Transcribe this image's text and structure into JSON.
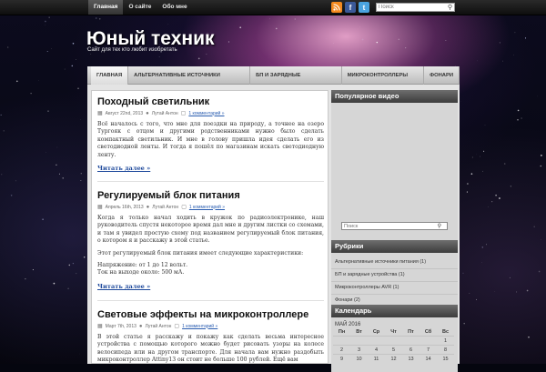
{
  "topnav": [
    {
      "label": "Главная",
      "active": true
    },
    {
      "label": "О сайте",
      "active": false
    },
    {
      "label": "Обо мне",
      "active": false
    }
  ],
  "social": {
    "rss": {
      "icon": "rss-icon",
      "color": "#f58a1f"
    },
    "facebook": {
      "icon": "facebook-icon",
      "glyph": "f",
      "color": "#3b5998"
    },
    "twitter": {
      "icon": "twitter-icon",
      "glyph": "t",
      "color": "#4aa3df"
    }
  },
  "top_search": {
    "placeholder": "Поиск"
  },
  "site": {
    "title": "Юный техник",
    "description": "Сайт для тех кто любит изобретать"
  },
  "mainnav": [
    {
      "label": "ГЛАВНАЯ",
      "active": true
    },
    {
      "label": "АЛЬТЕРНАТИВНЫЕ ИСТОЧНИКИ ПИТАНИЯ",
      "active": false
    },
    {
      "label": "БП И ЗАРЯДНЫЕ УСТРОЙСТВА",
      "active": false
    },
    {
      "label": "МИКРОКОНТРОЛЛЕРЫ AVR",
      "active": false
    },
    {
      "label": "ФОНАРИ",
      "active": false
    }
  ],
  "posts": [
    {
      "title": "Походный светильник",
      "date": "Август 22nd, 2013",
      "author": "Лутай Антон",
      "comments": "1 комментарий »",
      "paragraphs": [
        "Всё началось с того, что мне для поездки на природу, а точнее на озеро Тургояк с отцом и другими родственниками нужно было сделать компактный светильник. И мне в голову пришла идея сделать его из светодиодной ленты. И тогда я пошёл по магазинам искать светодиодную ленту."
      ],
      "more": "Читать далее »"
    },
    {
      "title": "Регулируемый блок питания",
      "date": "Апрель 16th, 2013",
      "author": "Лутай Антон",
      "comments": "1 комментарий »",
      "paragraphs": [
        "Когда я только начал ходить в кружок по радиоэлектронике, наш руководитель спустя некоторое время дал мне и другим листки со схемами, и там я увидел простую схему под названием регулируемый блок питания, о котором я и расскажу в этой статье.",
        "Этот регулируемый блок питания имеет следующие характеристики:",
        "Напряжение: от 1 до 12 вольт.\nТок на выходе около: 500 мА."
      ],
      "more": "Читать далее »"
    },
    {
      "title": "Световые эффекты на микроконтроллере",
      "date": "Март 7th, 2013",
      "author": "Лутай Антон",
      "comments": "1 комментарий »",
      "paragraphs": [
        "В этой статье я расскажу и покажу как сделать весьма интересное устройства с помощью которого можно будет рисовать узоры на колесе велосипеда или на другом транспорте. Для начала вам нужно раздобыть микроконтроллер Attiny13 он стоит не больше 100 рублей. Ещё вам"
      ],
      "more": ""
    }
  ],
  "sidebar": {
    "popular_video": "Популярное видео",
    "search_placeholder": "Поиск",
    "categories_title": "Рубрики",
    "categories": [
      "Альтернативные источники питания (1)",
      "БП и зарядные устройства (1)",
      "Микроконтроллеры AVR (1)",
      "Фонари (2)"
    ],
    "calendar_title": "Календарь",
    "calendar_caption": "МАЙ 2016",
    "weekdays": [
      "Пн",
      "Вт",
      "Ср",
      "Чт",
      "Пт",
      "Сб",
      "Вс"
    ],
    "weeks": [
      [
        "",
        "",
        "",
        "",
        "",
        "",
        "1"
      ],
      [
        "2",
        "3",
        "4",
        "5",
        "6",
        "7",
        "8"
      ],
      [
        "9",
        "10",
        "11",
        "12",
        "13",
        "14",
        "15"
      ]
    ]
  }
}
